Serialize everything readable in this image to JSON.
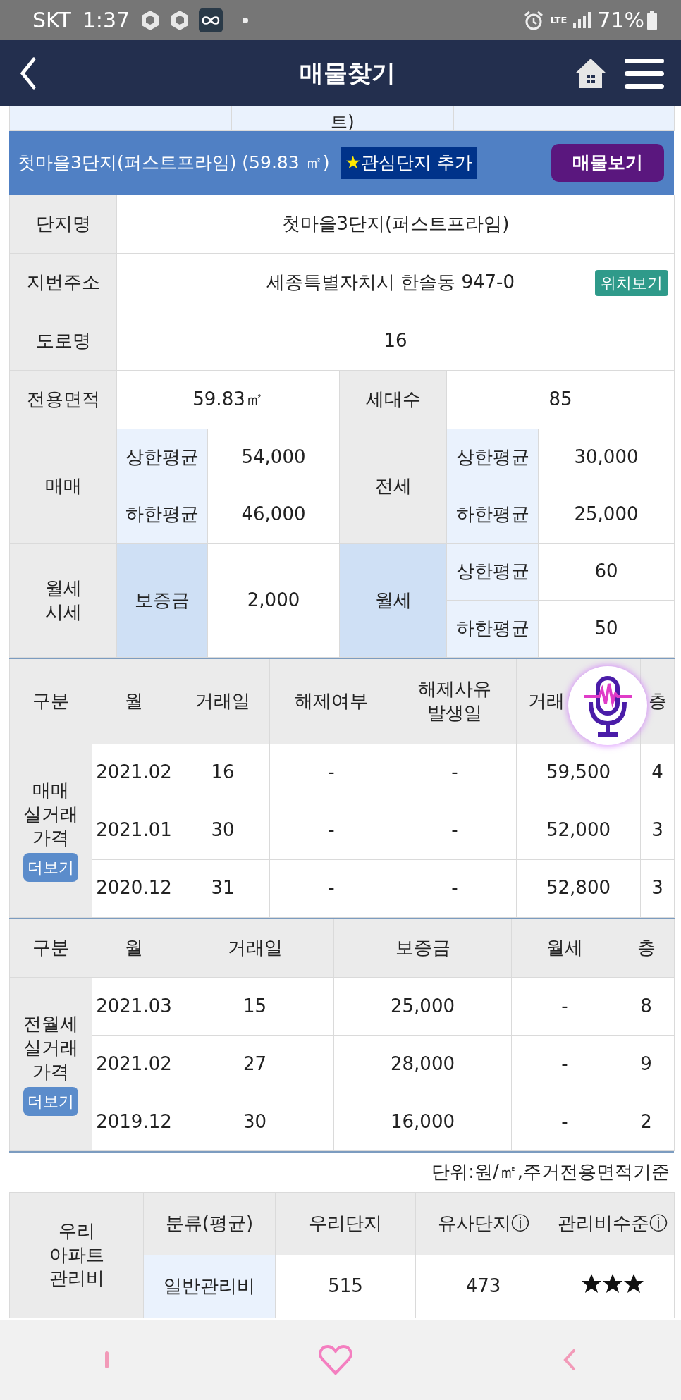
{
  "status_bar": {
    "carrier": "SKT",
    "time": "1:37",
    "network": "LTE",
    "battery": "71%"
  },
  "header": {
    "title": "매물찾기"
  },
  "cut_row": {
    "text": "트)"
  },
  "complex_bar": {
    "title": "첫마을3단지(퍼스트프라임) (59.83 ㎡)",
    "favorite_star": "★",
    "favorite": "관심단지 추가",
    "listings_button": "매물보기"
  },
  "info_rows": [
    {
      "kind": "full",
      "label": "단지명",
      "value": "첫마을3단지(퍼스트프라임)"
    },
    {
      "kind": "full",
      "label": "지번주소",
      "value": "세종특별자치시 한솔동 947-0",
      "button": "위치보기"
    },
    {
      "kind": "full",
      "label": "도로명",
      "value": "16"
    },
    {
      "kind": "pair",
      "label": "전용면적",
      "value": "59.83㎡",
      "label2": "세대수",
      "value2": "85"
    }
  ],
  "prices": {
    "sale": {
      "label": "매매",
      "upper_label": "상한평균",
      "upper": "54,000",
      "lower_label": "하한평균",
      "lower": "46,000"
    },
    "jeonse": {
      "label": "전세",
      "upper_label": "상한평균",
      "upper": "30,000",
      "lower_label": "하한평균",
      "lower": "25,000"
    },
    "monthly": {
      "label": "월세\n시세",
      "deposit_label": "보증금",
      "deposit": "2,000",
      "rent_label": "월세",
      "upper_label": "상한평균",
      "upper": "60",
      "lower_label": "하한평균",
      "lower": "50"
    }
  },
  "trade_tables": [
    {
      "label": "매매\n실거래\n가격",
      "more": "더보기",
      "columns": [
        "구분",
        "월",
        "거래일",
        "해제여부",
        "해제사유\n발생일",
        "거래",
        "층"
      ],
      "rows": [
        [
          "",
          "2021.02",
          "16",
          "-",
          "-",
          "59,500",
          "4"
        ],
        [
          "",
          "2021.01",
          "30",
          "-",
          "-",
          "52,000",
          "3"
        ],
        [
          "",
          "2020.12",
          "31",
          "-",
          "-",
          "52,800",
          "3"
        ]
      ]
    },
    {
      "label": "전월세\n실거래\n가격",
      "more": "더보기",
      "columns": [
        "구분",
        "월",
        "거래일",
        "보증금",
        "월세",
        "층"
      ],
      "rows": [
        [
          "",
          "2021.03",
          "15",
          "25,000",
          "-",
          "8"
        ],
        [
          "",
          "2021.02",
          "27",
          "28,000",
          "-",
          "9"
        ],
        [
          "",
          "2019.12",
          "30",
          "16,000",
          "-",
          "2"
        ]
      ]
    }
  ],
  "unit_note": "단위:원/㎡,주거전용면적기준",
  "maintenance": {
    "label": "우리\n아파트\n관리비",
    "columns": [
      "분류(평균)",
      "우리단지",
      "유사단지ⓘ",
      "관리비수준ⓘ"
    ],
    "rows": [
      {
        "category": "일반관리비",
        "ours": "515",
        "similar": "473",
        "stars": 3
      }
    ]
  }
}
